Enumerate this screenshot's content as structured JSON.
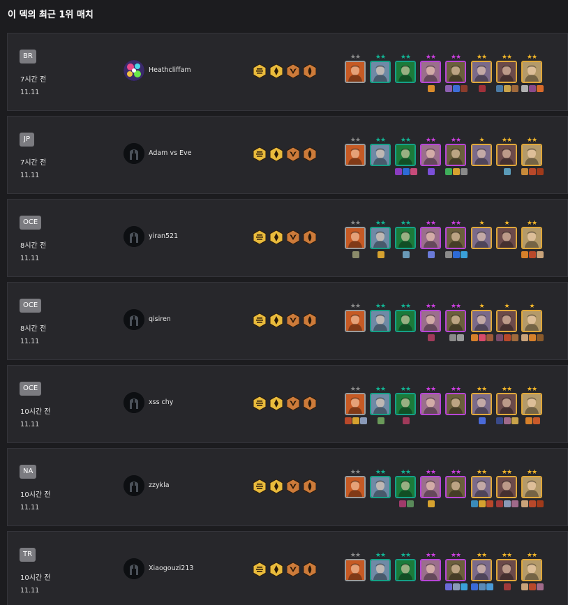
{
  "title": "이 덱의 최근 1위 매치",
  "colors": {
    "star_gray": "#8a8a8a",
    "star_teal": "#12b292",
    "star_purple": "#cc3fe0",
    "star_gold": "#f0b429",
    "cost1_border": "#9c9c9c",
    "cost2_border": "#15a087",
    "cost3_border": "#2a8bd6",
    "cost4_border": "#b746d6",
    "cost5_border": "#e0a83a",
    "trait_gold": "#e9bb3c",
    "trait_bronze": "#cd7b3a"
  },
  "trait_icons": [
    "gold-layered-trait-icon",
    "gold-spike-trait-icon",
    "bronze-wing-trait-icon",
    "bronze-flame-trait-icon"
  ],
  "units": [
    {
      "name": "unit-portrait-1",
      "cost": 1,
      "color": "#c65a24"
    },
    {
      "name": "unit-portrait-2",
      "cost": 2,
      "color": "#6f8aa6"
    },
    {
      "name": "unit-portrait-3",
      "cost": 2,
      "color": "#1b7a3a"
    },
    {
      "name": "unit-portrait-4",
      "cost": 4,
      "color": "#9b6f8c"
    },
    {
      "name": "unit-portrait-5",
      "cost": 4,
      "color": "#6a5f3c"
    },
    {
      "name": "unit-portrait-6",
      "cost": 5,
      "color": "#7a6a8a"
    },
    {
      "name": "unit-portrait-7",
      "cost": 5,
      "color": "#6b4a4a"
    },
    {
      "name": "unit-portrait-8",
      "cost": 5,
      "color": "#b49a6a"
    }
  ],
  "matches": [
    {
      "region": "BR",
      "time_ago": "7시간 전",
      "patch": "11.11",
      "player": "Heathcliffam",
      "avatar": "custom-avatar",
      "stars": [
        2,
        2,
        2,
        2,
        2,
        2,
        2,
        2
      ],
      "items": [
        [],
        [],
        [],
        [
          "#d98b2b"
        ],
        [
          "#8c5fb0",
          "#3d6ed8",
          "#8a3c2c"
        ],
        [
          "#a0303a"
        ],
        [
          "#4b7aa4",
          "#c9a34a",
          "#a06a3c"
        ],
        [
          "#b0b0b0",
          "#8a4a8a",
          "#d86a2a"
        ]
      ]
    },
    {
      "region": "JP",
      "time_ago": "7시간 전",
      "patch": "11.11",
      "player": "Adam vs Eve",
      "avatar": "default-avatar",
      "stars": [
        2,
        2,
        2,
        2,
        2,
        1,
        2,
        2
      ],
      "items": [
        [],
        [],
        [
          "#8a3cbf",
          "#2d6ad6",
          "#c74b7a"
        ],
        [
          "#7b4fd8"
        ],
        [
          "#3fae5a",
          "#d6a22f",
          "#8a8a8a"
        ],
        [],
        [
          "#5a9ab8"
        ],
        [
          "#c78a3a",
          "#b8482a",
          "#a03a1a"
        ]
      ]
    },
    {
      "region": "OCE",
      "time_ago": "8시간 전",
      "patch": "11.11",
      "player": "yiran521",
      "avatar": "default-avatar",
      "stars": [
        2,
        2,
        2,
        2,
        2,
        1,
        1,
        2
      ],
      "items": [
        [
          "#8a8a6a"
        ],
        [
          "#d6a22f"
        ],
        [
          "#6a9ab8"
        ],
        [
          "#6a7ad8"
        ],
        [
          "#8a8a8a",
          "#2d6ad6",
          "#3aa0d8"
        ],
        [],
        [],
        [
          "#d6802a",
          "#b8482a",
          "#c9a37a"
        ]
      ]
    },
    {
      "region": "OCE",
      "time_ago": "8시간 전",
      "patch": "11.11",
      "player": "qisiren",
      "avatar": "default-avatar",
      "stars": [
        2,
        2,
        2,
        2,
        2,
        1,
        1,
        1
      ],
      "items": [
        [],
        [],
        [],
        [
          "#a03a5a"
        ],
        [
          "#8a8a8a",
          "#9a9a9a"
        ],
        [
          "#d6802a",
          "#d84a6a",
          "#a05a3a"
        ],
        [
          "#7a4a6a",
          "#b8482a",
          "#a06a3c"
        ],
        [
          "#c9a37a",
          "#d6802a",
          "#8a5a2a"
        ]
      ]
    },
    {
      "region": "OCE",
      "time_ago": "10시간 전",
      "patch": "11.11",
      "player": "xss chy",
      "avatar": "default-avatar",
      "stars": [
        2,
        2,
        2,
        2,
        2,
        2,
        2,
        2
      ],
      "items": [
        [
          "#b8482a",
          "#d6a22f",
          "#8a9ab8"
        ],
        [
          "#6a9a5a"
        ],
        [
          "#a03a5a"
        ],
        [],
        [],
        [
          "#4a6ad8"
        ],
        [
          "#3a4a8a",
          "#a06a8a",
          "#c9a34a"
        ],
        [
          "#d6802a",
          "#c95a2a"
        ]
      ]
    },
    {
      "region": "NA",
      "time_ago": "10시간 전",
      "patch": "11.11",
      "player": "zzykla",
      "avatar": "default-avatar",
      "stars": [
        2,
        2,
        2,
        2,
        2,
        2,
        2,
        2
      ],
      "items": [
        [],
        [],
        [
          "#a03a6a",
          "#5a8a5a"
        ],
        [
          "#d6a22f"
        ],
        [],
        [
          "#3a8ab8",
          "#d6a22f",
          "#b8482a"
        ],
        [
          "#a03a3a",
          "#8a9ab8",
          "#a06a8a"
        ],
        [
          "#c9a37a",
          "#b8482a",
          "#a03a1a"
        ]
      ]
    },
    {
      "region": "TR",
      "time_ago": "10시간 전",
      "patch": "11.11",
      "player": "Xiaogouzi213",
      "avatar": "default-avatar",
      "stars": [
        2,
        2,
        2,
        2,
        2,
        2,
        2,
        2
      ],
      "items": [
        [],
        [],
        [],
        [],
        [
          "#6a6ad8",
          "#8a9ab8",
          "#3aa0d8"
        ],
        [
          "#3a6ad8",
          "#5a8ab8",
          "#4a9ad8"
        ],
        [
          "#a03a3a"
        ],
        [
          "#c9a37a",
          "#b8482a",
          "#a06a8a"
        ]
      ]
    }
  ]
}
